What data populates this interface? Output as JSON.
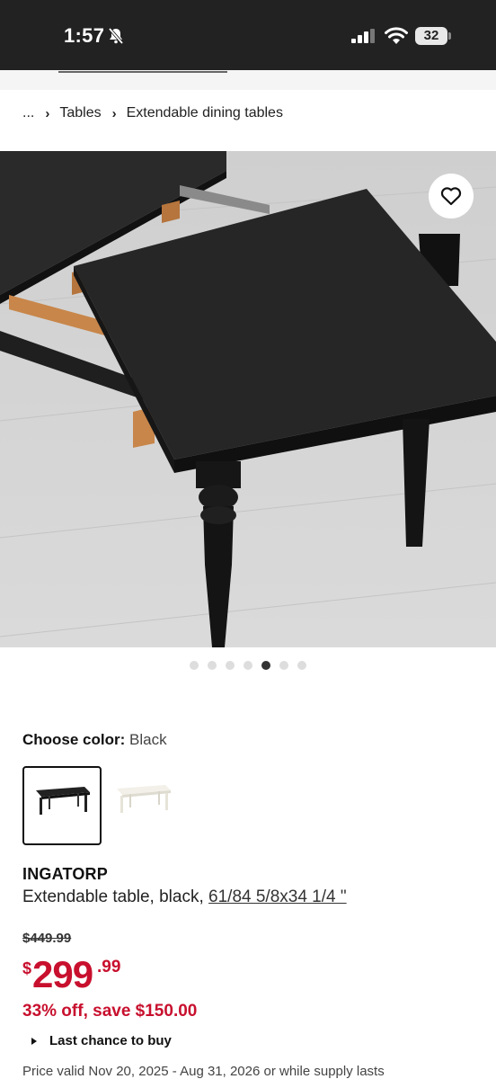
{
  "status_bar": {
    "time": "1:57",
    "battery": "32"
  },
  "breadcrumb": {
    "ellipsis": "...",
    "items": [
      "Tables",
      "Extendable dining tables"
    ]
  },
  "carousel": {
    "total": 7,
    "active_index": 4
  },
  "color_chooser": {
    "label": "Choose color:",
    "value": "Black",
    "options": [
      "Black",
      "White"
    ]
  },
  "product": {
    "name": "INGATORP",
    "description": "Extendable table, black,",
    "dimensions": "61/84 5/8x34 1/4 \""
  },
  "pricing": {
    "old_price": "$449.99",
    "currency": "$",
    "price_integer": "299",
    "price_decimal": ".99",
    "discount": "33% off, save $150.00",
    "last_chance": "Last chance to buy",
    "valid": "Price valid Nov 20, 2025 - Aug 31, 2026 or while supply lasts"
  },
  "colors": {
    "status_bar_bg": "#222222",
    "sale_red": "#c8102e",
    "dot_active": "#333333",
    "dot_inactive": "#dddddd"
  }
}
